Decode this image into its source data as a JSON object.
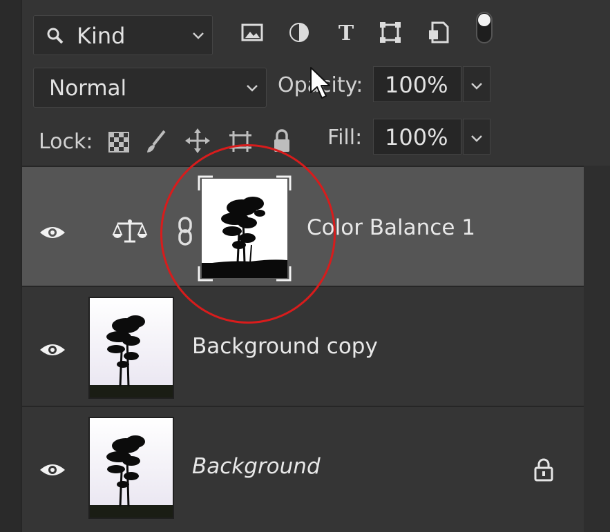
{
  "filter_bar": {
    "kind_label": "Kind",
    "icons": [
      "pixel-layer-filter-icon",
      "adjustment-layer-filter-icon",
      "type-layer-filter-icon",
      "shape-layer-filter-icon",
      "smart-object-filter-icon",
      "filter-toggle-icon"
    ]
  },
  "blend": {
    "mode": "Normal",
    "opacity_label": "Opacity:",
    "opacity_value": "100%"
  },
  "lock": {
    "label": "Lock:",
    "icons": [
      "lock-transparent-pixels-icon",
      "lock-image-pixels-icon",
      "lock-position-icon",
      "prevent-auto-nest-icon",
      "lock-all-icon"
    ],
    "fill_label": "Fill:",
    "fill_value": "100%"
  },
  "layers": [
    {
      "name": "Color Balance 1",
      "type": "adjustment",
      "selected": true,
      "visible": true,
      "locked": false
    },
    {
      "name": "Background copy",
      "type": "pixel",
      "selected": false,
      "visible": true,
      "locked": false
    },
    {
      "name": "Background",
      "type": "pixel",
      "selected": false,
      "visible": true,
      "locked": true,
      "italic": true
    }
  ],
  "colors": {
    "panel_bg": "#343434",
    "selected_row": "#555555",
    "annotation_circle": "#d81c1c"
  }
}
